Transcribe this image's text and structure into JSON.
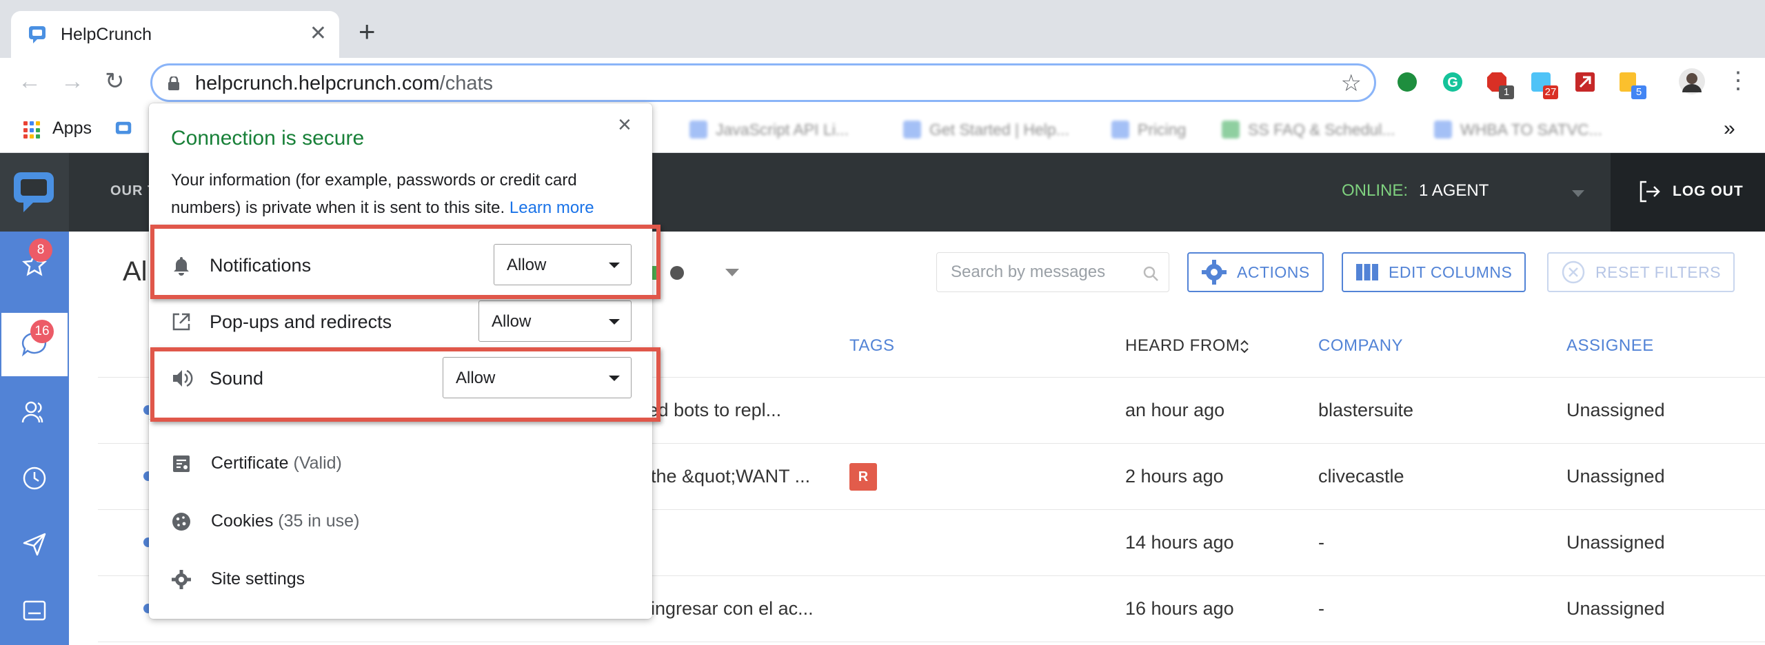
{
  "browser": {
    "tab_title": "HelpCrunch",
    "new_tab_label": "+",
    "url_host": "helpcrunch.helpcrunch.com",
    "url_path": "/chats",
    "extensions": [
      {
        "name": "green-circle-extension-icon",
        "color": "#1e8e3e",
        "badge": ""
      },
      {
        "name": "grammarly-extension-icon",
        "color": "#15c39a",
        "badge": ""
      },
      {
        "name": "red-extension-icon",
        "color": "#d93025",
        "badge": "1"
      },
      {
        "name": "blue-extension-icon",
        "color": "#4fc3f7",
        "badge": "27"
      },
      {
        "name": "red-arrow-extension-icon",
        "color": "#c62828",
        "badge": ""
      },
      {
        "name": "yellow-extension-icon",
        "color": "#fbc02d",
        "badge": "5"
      }
    ]
  },
  "bookmarks": {
    "apps_label": "Apps",
    "items": [
      {
        "label": "JavaScript API Li...",
        "color": "#5b8def"
      },
      {
        "label": "Get Started | Help...",
        "color": "#5b8def"
      },
      {
        "label": "Pricing",
        "color": "#5b8def"
      },
      {
        "label": "SS FAQ & Schedul...",
        "color": "#34a853"
      },
      {
        "label": "WHBA TO SATVC...",
        "color": "#5b8def"
      }
    ],
    "more_label": "»"
  },
  "app_header": {
    "team_label": "OUR T",
    "online_label": "ONLINE:",
    "online_count": "1 AGENT",
    "logout_label": "LOG OUT"
  },
  "sidebar": {
    "items": [
      {
        "name": "favorites",
        "badge": "8"
      },
      {
        "name": "chats",
        "badge": "16"
      },
      {
        "name": "contacts",
        "badge": ""
      },
      {
        "name": "history",
        "badge": ""
      },
      {
        "name": "send",
        "badge": ""
      },
      {
        "name": "widget",
        "badge": ""
      }
    ]
  },
  "main": {
    "title": "Al",
    "search_placeholder": "Search by messages",
    "actions_label": "ACTIONS",
    "edit_columns_label": "EDIT COLUMNS",
    "reset_filters_label": "RESET FILTERS",
    "columns": {
      "tags": "TAGS",
      "heard_from": "HEARD FROM",
      "company": "COMPANY",
      "assignee": "ASSIGNEE"
    },
    "rows": [
      {
        "message": "nated bots to repl...",
        "tag": "",
        "heard_from": "an hour ago",
        "company": "blastersuite",
        "assignee": "Unassigned"
      },
      {
        "message": "the &quot;WANT ...",
        "tag": "R",
        "heard_from": "2 hours ago",
        "company": "clivecastle",
        "assignee": "Unassigned"
      },
      {
        "message": "",
        "tag": "",
        "heard_from": "14 hours ago",
        "company": "-",
        "assignee": "Unassigned"
      },
      {
        "message": "ingresar con el ac...",
        "tag": "",
        "heard_from": "16 hours ago",
        "company": "-",
        "assignee": "Unassigned"
      }
    ]
  },
  "popup": {
    "close_label": "×",
    "title": "Connection is secure",
    "description": "Your information (for example, passwords or credit card numbers) is private when it is sent to this site.",
    "learn_more": "Learn more",
    "permissions": {
      "notifications": {
        "label": "Notifications",
        "value": "Allow"
      },
      "popups": {
        "label": "Pop-ups and redirects",
        "value": "Allow"
      },
      "sound": {
        "label": "Sound",
        "value": "Allow"
      }
    },
    "certificate": {
      "label": "Certificate",
      "detail": "(Valid)"
    },
    "cookies": {
      "label": "Cookies",
      "detail": "(35 in use)"
    },
    "site_settings": {
      "label": "Site settings"
    }
  },
  "colors": {
    "accent": "#5283d6",
    "highlight": "#e0574a",
    "secure_green": "#188038",
    "badge_red": "#ec5b67"
  }
}
